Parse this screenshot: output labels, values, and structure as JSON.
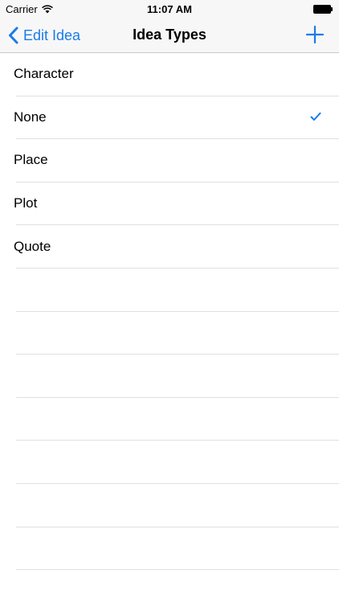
{
  "status_bar": {
    "carrier": "Carrier",
    "time": "11:07 AM"
  },
  "nav": {
    "back_label": "Edit Idea",
    "title": "Idea Types"
  },
  "items": [
    {
      "label": "Character",
      "selected": false
    },
    {
      "label": "None",
      "selected": true
    },
    {
      "label": "Place",
      "selected": false
    },
    {
      "label": "Plot",
      "selected": false
    },
    {
      "label": "Quote",
      "selected": false
    }
  ],
  "colors": {
    "accent": "#1a7bea",
    "separator": "#e0e0e3",
    "bar_background": "#f7f7f7"
  }
}
